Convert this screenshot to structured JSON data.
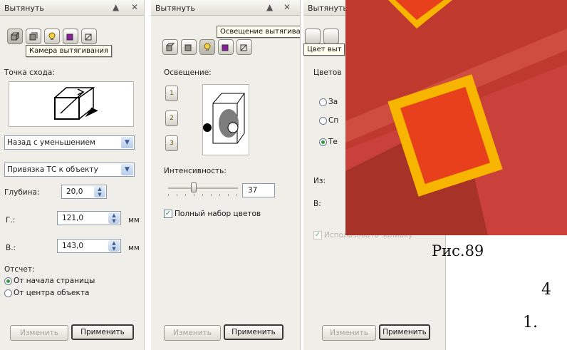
{
  "panel1": {
    "title": "Вытянуть",
    "controls": "▲ X",
    "tooltip": "Камера вытягивания",
    "vanishing_label": "Точка схода:",
    "vanishing_select": "Назад с уменьшением",
    "lock_select": "Привязка ТС к объекту",
    "depth_label": "Глубина:",
    "depth_value": "20,0",
    "h_label": "Г.:",
    "h_value": "121,0",
    "v_label": "В.:",
    "v_value": "143,0",
    "unit": "мм",
    "measure_label": "Отсчет:",
    "radio_page": "От начала страницы",
    "radio_object": "От центра объекта",
    "edit_button": "Изменить",
    "apply_button": "Применить"
  },
  "panel2": {
    "title": "Вытянуть",
    "controls": "▲ X",
    "tooltip": "Освещение вытягивания",
    "lighting_label": "Освещение:",
    "light_buttons": [
      "1",
      "2",
      "3"
    ],
    "intensity_label": "Интенсивность:",
    "intensity_value": "37",
    "intensity_fraction": 0.37,
    "full_colors_label": "Полный набор цветов",
    "edit_button": "Изменить",
    "apply_button": "Применить"
  },
  "panel3": {
    "title": "Вытянуть",
    "tooltip": "Цвет выт",
    "color_label": "Цветов",
    "radio_1": "За",
    "radio_2": "Сп",
    "radio_3": "Те",
    "from_label": "Из:",
    "to_label": "В:",
    "checkbox_label": "Использовать заливку",
    "edit_button": "Изменить",
    "apply_button": "Применить"
  },
  "document": {
    "caption": "Рис.89",
    "number": "4",
    "list_marker": "1."
  },
  "colors": {
    "panel_bg": "#efeee8",
    "photo_bg": "#c9413a",
    "photo_square": "#e8401c",
    "photo_frame": "#f7b500"
  }
}
